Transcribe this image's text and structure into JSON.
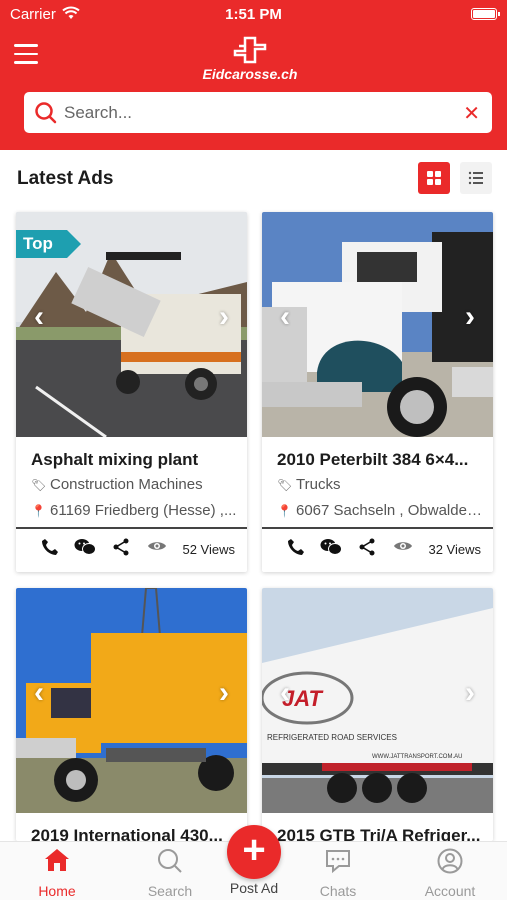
{
  "status_bar": {
    "carrier": "Carrier",
    "time": "1:51 PM"
  },
  "header": {
    "logo_text": "Eidcarosse.ch",
    "brand_color": "#ea2a2a"
  },
  "search": {
    "placeholder": "Search...",
    "value": ""
  },
  "section": {
    "title": "Latest Ads",
    "view_mode": "grid"
  },
  "ads": [
    {
      "badge": "Top",
      "title": "Asphalt mixing plant",
      "category": "Construction Machines",
      "location": "61169 Friedberg (Hesse) ,...",
      "views": "52 Views"
    },
    {
      "badge": "",
      "title": "2010 Peterbilt 384 6×4...",
      "category": "Trucks",
      "location": "6067 Sachseln , Obwalden...",
      "views": "32 Views"
    },
    {
      "badge": "",
      "title": "2019 International 430...",
      "category": "",
      "location": "",
      "views": ""
    },
    {
      "badge": "",
      "title": "2015 GTB Tri/A Refriger...",
      "category": "",
      "location": "",
      "views": ""
    }
  ],
  "ad_images_text": {
    "trailer_brand": "ROAD SERVICES",
    "trailer_line": "REFRIGERATED ROAD SERVICES",
    "trailer_web": "WWW.JATTRANSPORT.COM.AU"
  },
  "bottom_nav": {
    "items": [
      {
        "label": "Home",
        "icon": "home-icon",
        "active": true
      },
      {
        "label": "Search",
        "icon": "search-icon",
        "active": false
      },
      {
        "label": "Post Ad",
        "icon": "plus-icon",
        "active": false
      },
      {
        "label": "Chats",
        "icon": "chat-icon",
        "active": false
      },
      {
        "label": "Account",
        "icon": "account-icon",
        "active": false
      }
    ]
  }
}
